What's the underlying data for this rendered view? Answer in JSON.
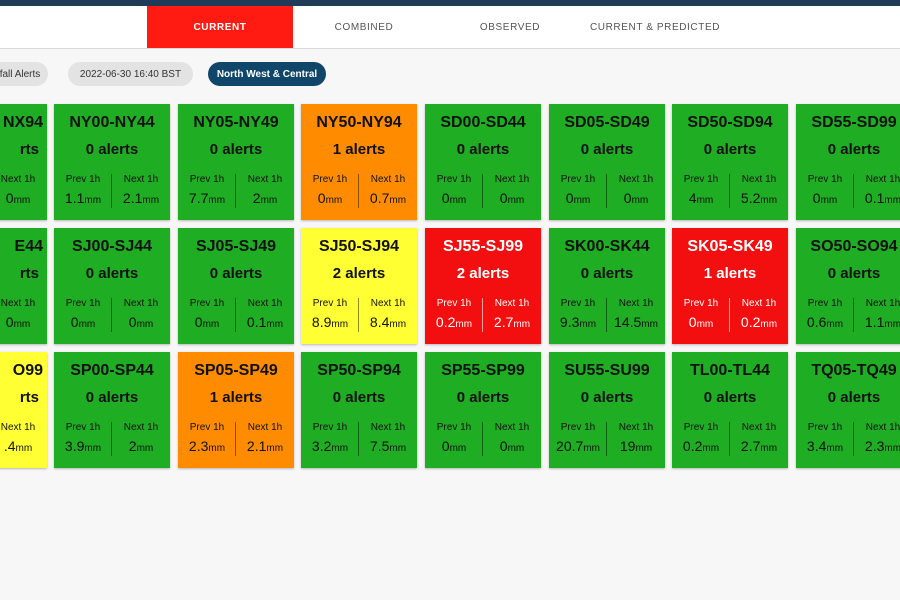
{
  "tabs": [
    {
      "label": "CURRENT",
      "active": true
    },
    {
      "label": "COMBINED",
      "active": false
    },
    {
      "label": "OBSERVED",
      "active": false
    },
    {
      "label": "CURRENT & PREDICTED",
      "active": false
    }
  ],
  "filters": {
    "alerts_chip": "fall Alerts",
    "timestamp": "2022-06-30 16:40 BST",
    "region": "North West & Central"
  },
  "colors": {
    "green": "#1fad23",
    "orange": "#ff8c00",
    "yellow": "#ffff33",
    "red": "#f30f0f",
    "brand": "#0f466a"
  },
  "labels": {
    "prev": "Prev 1h",
    "next": "Next 1h",
    "unit": "mm"
  },
  "tiles": [
    [
      {
        "code": "NX94",
        "alerts": "rts",
        "prev": "",
        "next": "0",
        "status": "green"
      },
      {
        "code": "NY00-NY44",
        "alerts": "0 alerts",
        "prev": "1.1",
        "next": "2.1",
        "status": "green"
      },
      {
        "code": "NY05-NY49",
        "alerts": "0 alerts",
        "prev": "7.7",
        "next": "2",
        "status": "green"
      },
      {
        "code": "NY50-NY94",
        "alerts": "1 alerts",
        "prev": "0",
        "next": "0.7",
        "status": "orange"
      },
      {
        "code": "SD00-SD44",
        "alerts": "0 alerts",
        "prev": "0",
        "next": "0",
        "status": "green"
      },
      {
        "code": "SD05-SD49",
        "alerts": "0 alerts",
        "prev": "0",
        "next": "0",
        "status": "green"
      },
      {
        "code": "SD50-SD94",
        "alerts": "0 alerts",
        "prev": "4",
        "next": "5.2",
        "status": "green"
      },
      {
        "code": "SD55-SD99",
        "alerts": "0 alerts",
        "prev": "0",
        "next": "0.1",
        "status": "green"
      }
    ],
    [
      {
        "code": "E44",
        "alerts": "rts",
        "prev": "",
        "next": "0",
        "status": "green"
      },
      {
        "code": "SJ00-SJ44",
        "alerts": "0 alerts",
        "prev": "0",
        "next": "0",
        "status": "green"
      },
      {
        "code": "SJ05-SJ49",
        "alerts": "0 alerts",
        "prev": "0",
        "next": "0.1",
        "status": "green"
      },
      {
        "code": "SJ50-SJ94",
        "alerts": "2 alerts",
        "prev": "8.9",
        "next": "8.4",
        "status": "yellow"
      },
      {
        "code": "SJ55-SJ99",
        "alerts": "2 alerts",
        "prev": "0.2",
        "next": "2.7",
        "status": "red"
      },
      {
        "code": "SK00-SK44",
        "alerts": "0 alerts",
        "prev": "9.3",
        "next": "14.5",
        "status": "green"
      },
      {
        "code": "SK05-SK49",
        "alerts": "1 alerts",
        "prev": "0",
        "next": "0.2",
        "status": "red"
      },
      {
        "code": "SO50-SO94",
        "alerts": "0 alerts",
        "prev": "0.6",
        "next": "1.1",
        "status": "green"
      }
    ],
    [
      {
        "code": "O99",
        "alerts": "rts",
        "prev": "",
        "next": ".4",
        "status": "yellow"
      },
      {
        "code": "SP00-SP44",
        "alerts": "0 alerts",
        "prev": "3.9",
        "next": "2",
        "status": "green"
      },
      {
        "code": "SP05-SP49",
        "alerts": "1 alerts",
        "prev": "2.3",
        "next": "2.1",
        "status": "orange"
      },
      {
        "code": "SP50-SP94",
        "alerts": "0 alerts",
        "prev": "3.2",
        "next": "7.5",
        "status": "green"
      },
      {
        "code": "SP55-SP99",
        "alerts": "0 alerts",
        "prev": "0",
        "next": "0",
        "status": "green"
      },
      {
        "code": "SU55-SU99",
        "alerts": "0 alerts",
        "prev": "20.7",
        "next": "19",
        "status": "green"
      },
      {
        "code": "TL00-TL44",
        "alerts": "0 alerts",
        "prev": "0.2",
        "next": "2.7",
        "status": "green"
      },
      {
        "code": "TQ05-TQ49",
        "alerts": "0 alerts",
        "prev": "3.4",
        "next": "2.3",
        "status": "green"
      }
    ]
  ]
}
